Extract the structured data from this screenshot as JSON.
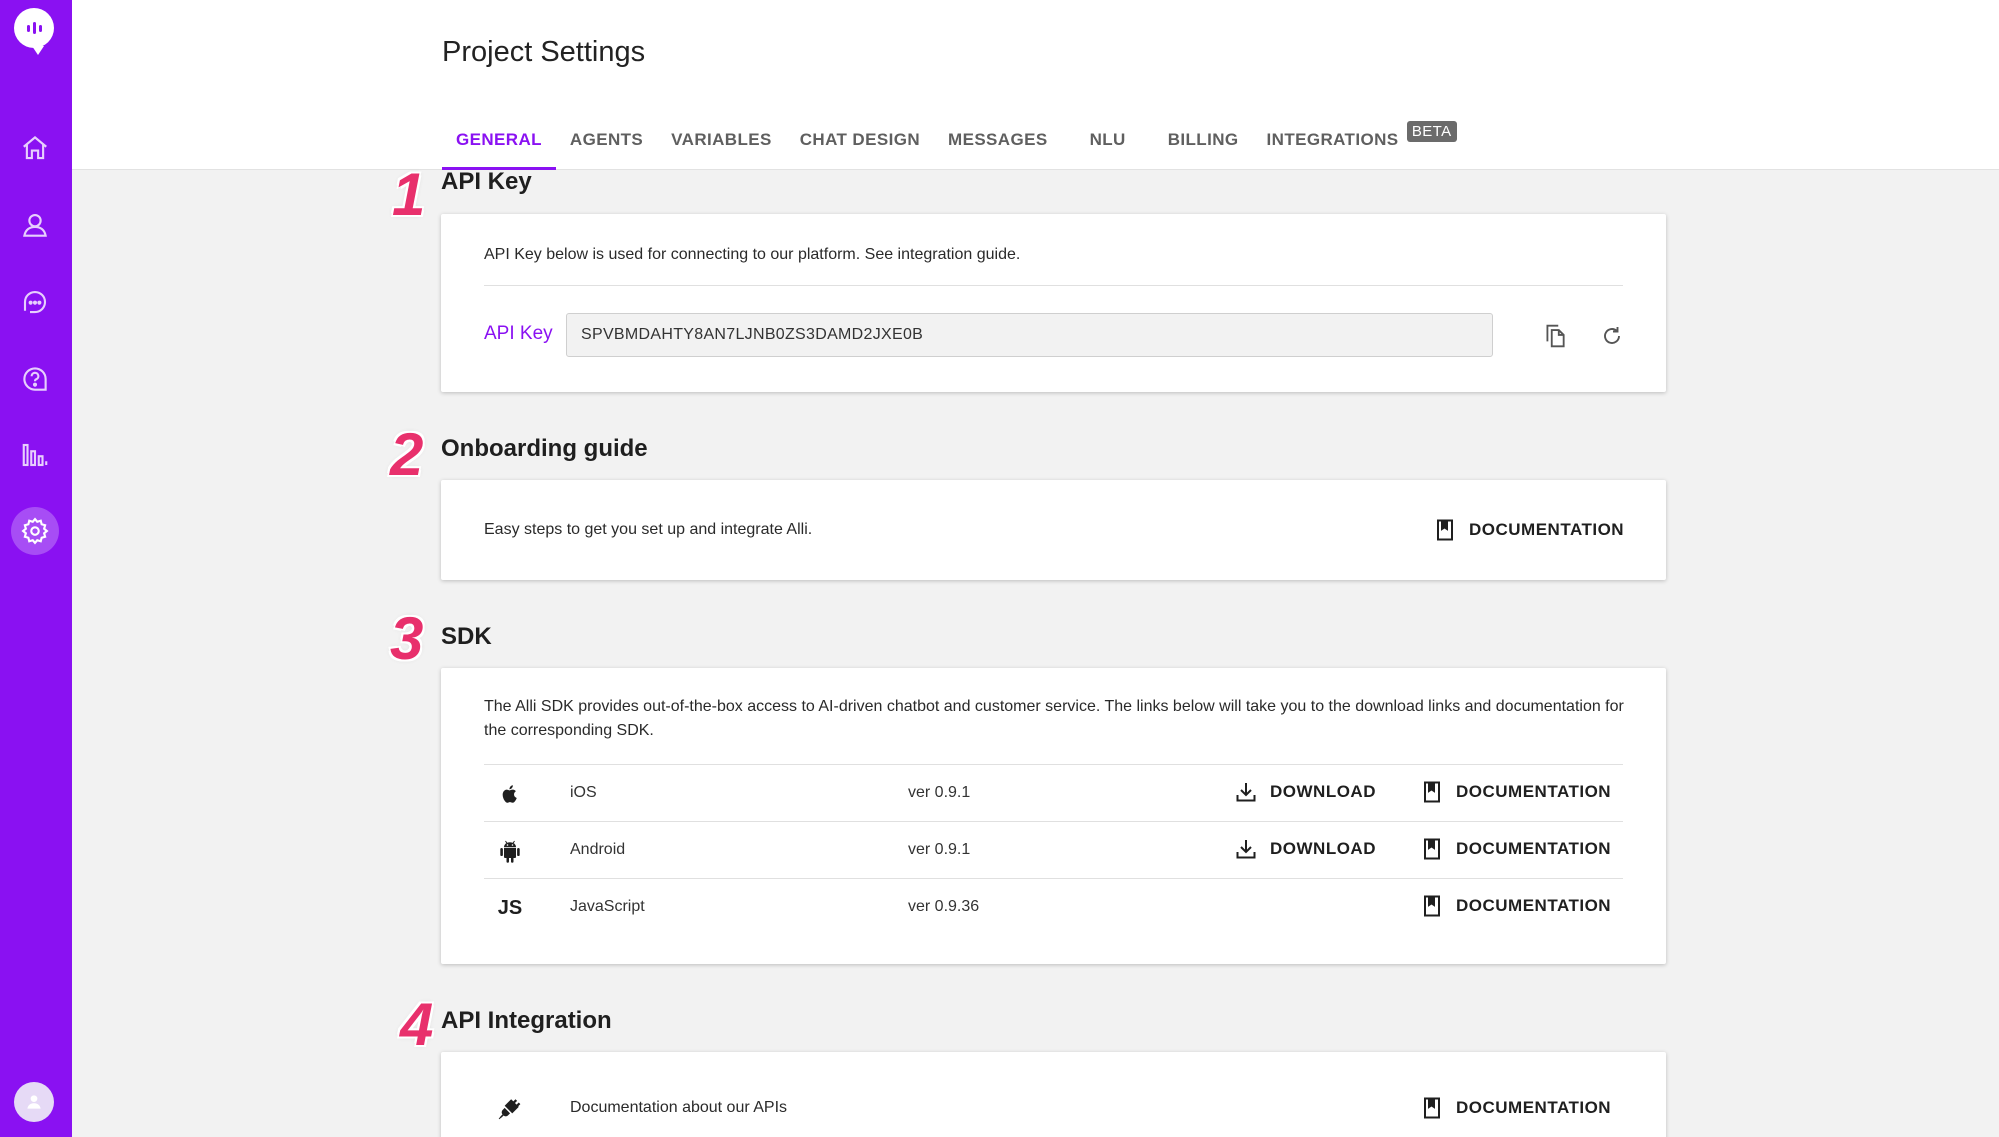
{
  "header": {
    "title": "Project Settings",
    "tabs": [
      {
        "label": "GENERAL",
        "active": true
      },
      {
        "label": "AGENTS"
      },
      {
        "label": "VARIABLES"
      },
      {
        "label": "CHAT DESIGN"
      },
      {
        "label": "MESSAGES"
      },
      {
        "label": "NLU"
      },
      {
        "label": "BILLING"
      },
      {
        "label": "INTEGRATIONS",
        "badge": "BETA"
      }
    ]
  },
  "sidebar": {
    "items": [
      {
        "icon": "home-icon"
      },
      {
        "icon": "user-icon"
      },
      {
        "icon": "chat-icon"
      },
      {
        "icon": "help-icon"
      },
      {
        "icon": "analytics-icon"
      },
      {
        "icon": "settings-icon",
        "active": true
      }
    ]
  },
  "steps": [
    "1",
    "2",
    "3",
    "4"
  ],
  "api_key": {
    "title": "API Key",
    "description": "API Key below is used for connecting to our platform. See integration guide.",
    "label": "API Key",
    "value": "SPVBMDAHTY8AN7LJNB0ZS3DAMD2JXE0B"
  },
  "onboarding": {
    "title": "Onboarding guide",
    "description": "Easy steps to get you set up and integrate Alli.",
    "doc_label": "DOCUMENTATION"
  },
  "sdk": {
    "title": "SDK",
    "description": "The Alli SDK provides out-of-the-box access to AI-driven chatbot and customer service. The links below will take you to the download links and documentation for the corresponding SDK.",
    "rows": [
      {
        "name": "iOS",
        "version": "ver 0.9.1",
        "download": "DOWNLOAD",
        "doc": "DOCUMENTATION"
      },
      {
        "name": "Android",
        "version": "ver 0.9.1",
        "download": "DOWNLOAD",
        "doc": "DOCUMENTATION"
      },
      {
        "name": "JavaScript",
        "icon_text": "JS",
        "version": "ver 0.9.36",
        "doc": "DOCUMENTATION"
      }
    ]
  },
  "api_integration": {
    "title": "API Integration",
    "description": "Documentation about our APIs",
    "doc_label": "DOCUMENTATION"
  },
  "colors": {
    "brand": "#8a11f2",
    "step": "#e8306c"
  }
}
